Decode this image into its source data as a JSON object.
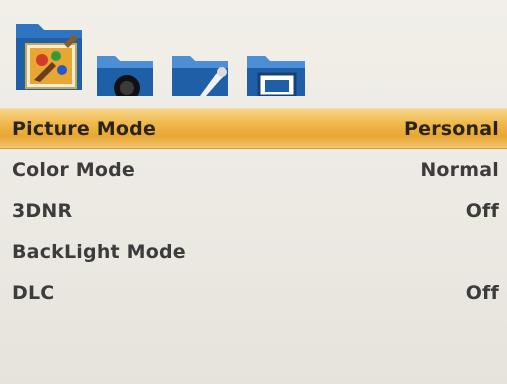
{
  "tabs": [
    {
      "icon": "picture-palette-icon",
      "selected": true
    },
    {
      "icon": "sound-speaker-icon",
      "selected": false
    },
    {
      "icon": "tools-wrench-icon",
      "selected": false
    },
    {
      "icon": "screen-monitor-icon",
      "selected": false
    }
  ],
  "colors": {
    "selection": "#f0b94e",
    "folder": "#1f5fa8",
    "folder_light": "#4d8fd4",
    "text": "#3c3c3c"
  },
  "menu": {
    "items": [
      {
        "label": "Picture Mode",
        "value": "Personal",
        "selected": true
      },
      {
        "label": "Color Mode",
        "value": "Normal",
        "selected": false
      },
      {
        "label": "3DNR",
        "value": "Off",
        "selected": false
      },
      {
        "label": "BackLight Mode",
        "value": "",
        "selected": false
      },
      {
        "label": "DLC",
        "value": "Off",
        "selected": false
      }
    ]
  }
}
